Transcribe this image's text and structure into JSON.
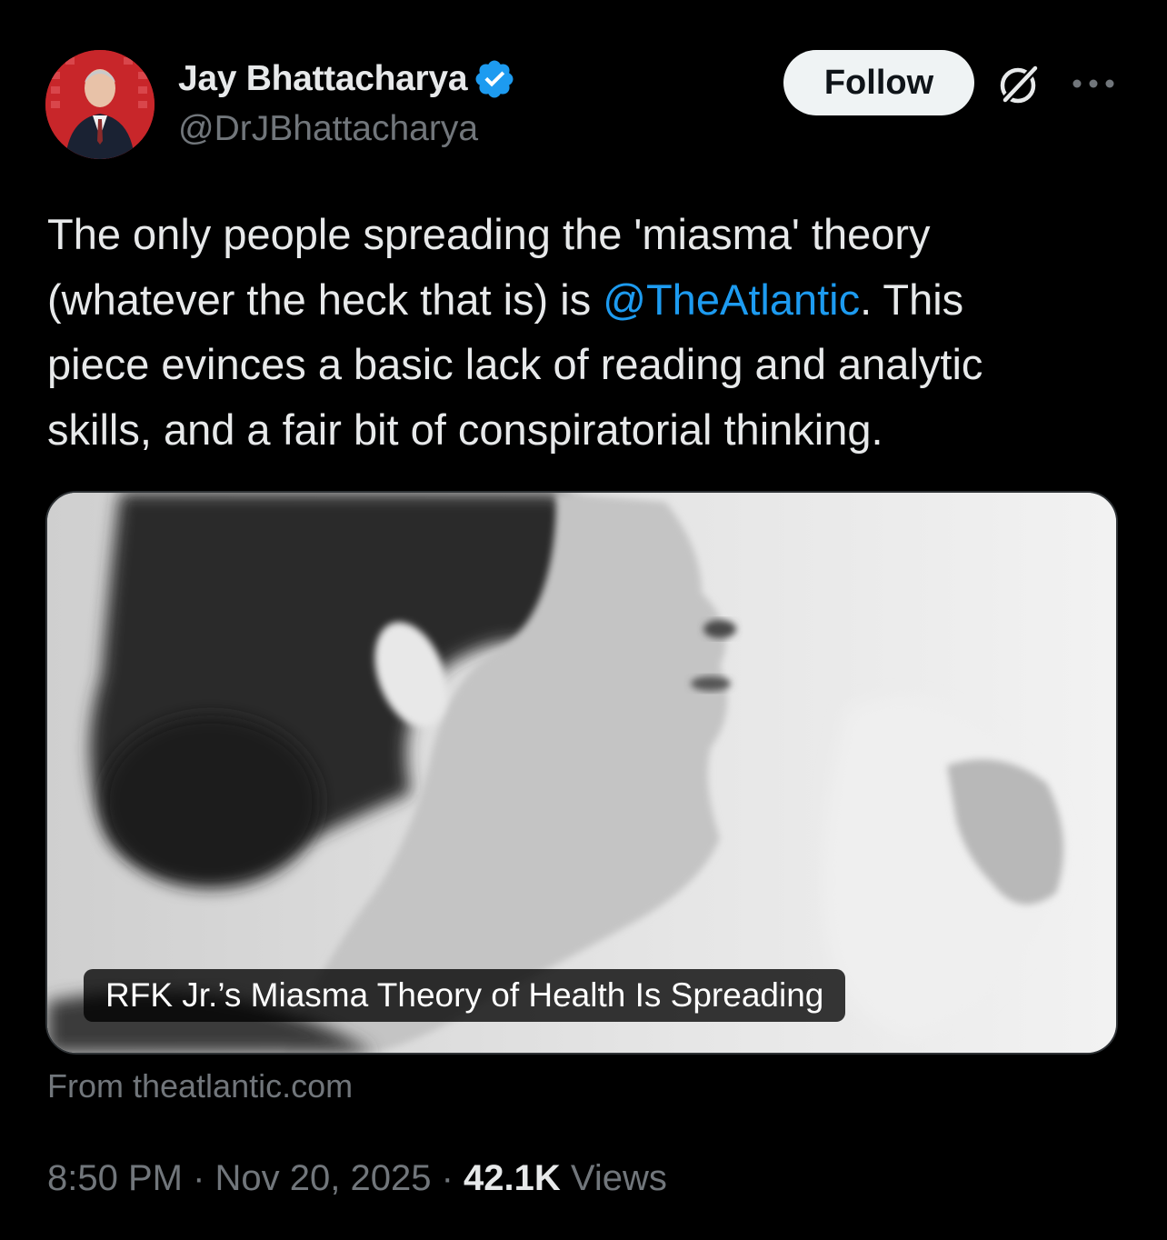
{
  "author": {
    "display_name": "Jay Bhattacharya",
    "handle": "@DrJBhattacharya",
    "avatar_icon": "profile-photo",
    "verified_icon": "verified-badge-icon",
    "verified_color": "#1d9bf0"
  },
  "actions": {
    "follow_label": "Follow",
    "grok_icon": "grok-icon",
    "more_icon": "more-options-icon"
  },
  "tweet": {
    "text_before": "The only people spreading the 'miasma' theory\n(whatever the heck that is) is ",
    "mention": "@TheAtlantic",
    "text_after": ".  This\npiece evinces a basic lack of reading and analytic\nskills, and a fair bit of conspiratorial thinking.",
    "mention_color": "#1d9bf0"
  },
  "link_card": {
    "title": "RFK Jr.’s Miasma Theory of Health Is Spreading",
    "source": "From theatlantic.com"
  },
  "meta": {
    "time": "8:50 PM",
    "separator": " · ",
    "date": "Nov 20, 2025",
    "views_count": "42.1K",
    "views_label": " Views"
  },
  "colors": {
    "background": "#000000",
    "text": "#e7e9ea",
    "muted": "#71767b",
    "accent": "#1d9bf0"
  }
}
